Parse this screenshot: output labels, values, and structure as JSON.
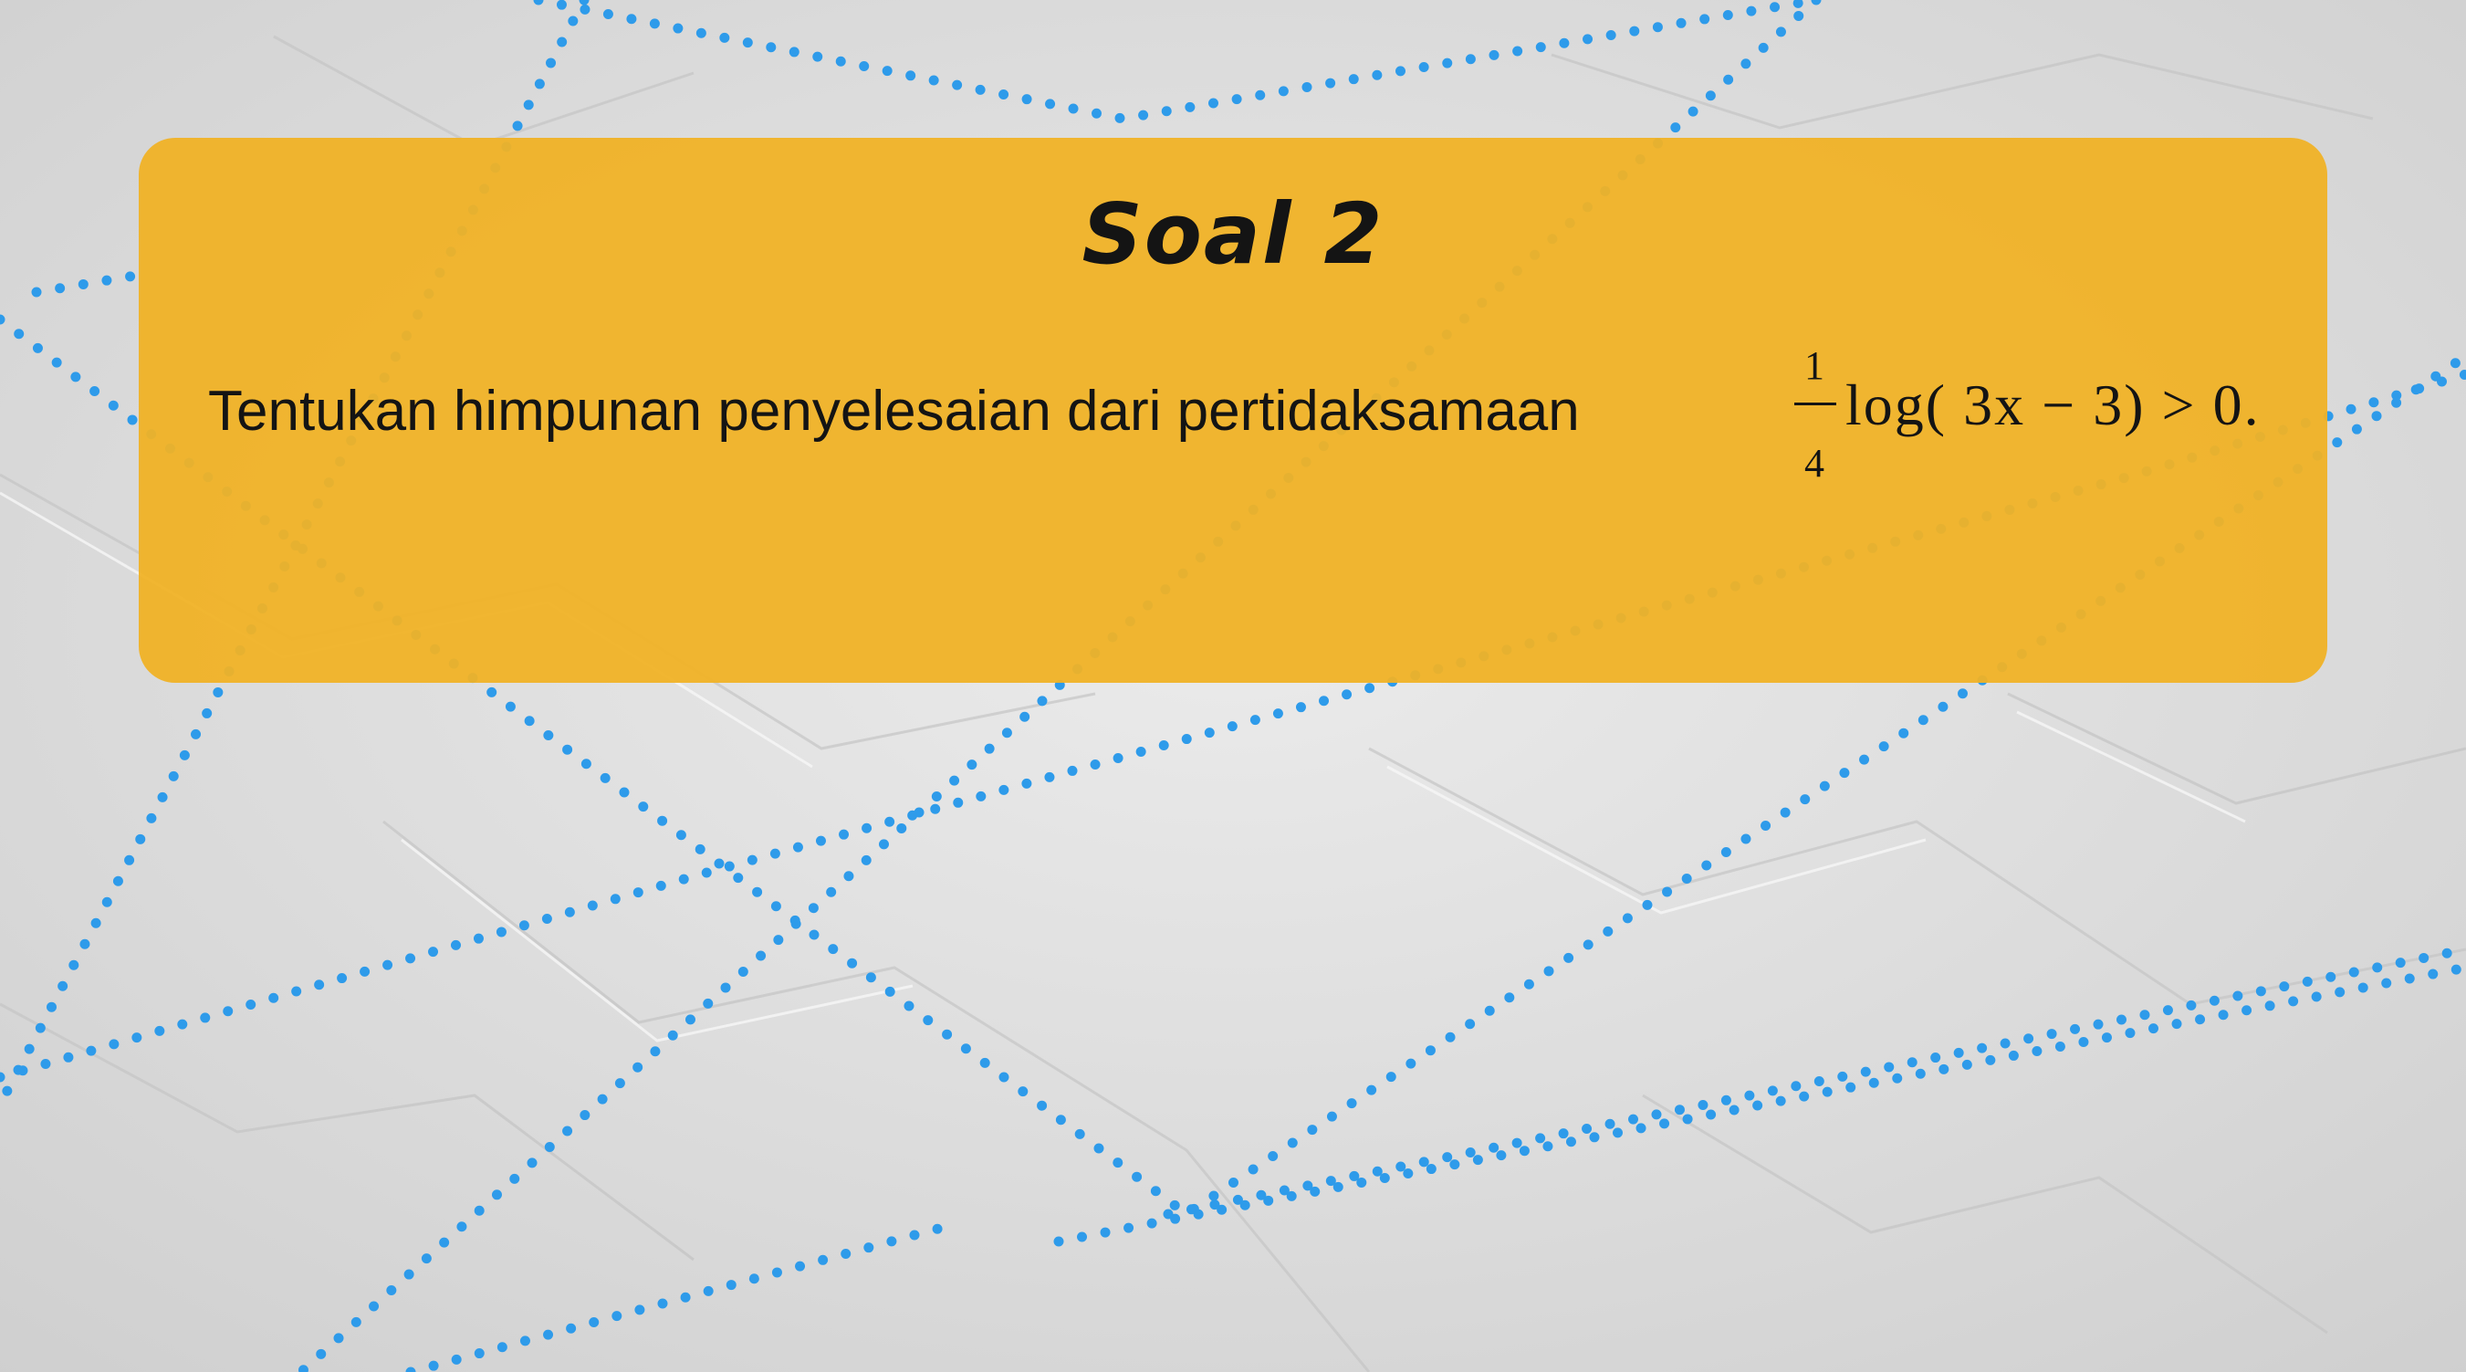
{
  "slide": {
    "title": "Soal 2",
    "question": "Tentukan himpunan penyelesaian dari pertidaksamaan",
    "math": {
      "base_numerator": "1",
      "base_denominator": "4",
      "expression": "log( 3x − 3) > 0."
    }
  },
  "colors": {
    "card": "#F0B226",
    "dots": "#2E9BEA",
    "background": "#D9D9D9",
    "text": "#141414"
  }
}
